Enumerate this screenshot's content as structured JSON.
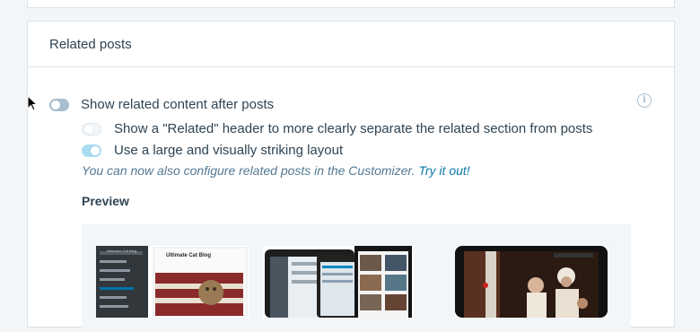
{
  "card": {
    "title": "Related posts"
  },
  "settings": {
    "show_related": {
      "label": "Show related content after posts",
      "enabled": false
    },
    "related_header": {
      "label": "Show a \"Related\" header to more clearly separate the related section from posts",
      "enabled": false
    },
    "large_layout": {
      "label": "Use a large and visually striking layout",
      "enabled": true
    }
  },
  "hint": {
    "text": "You can now also configure related posts in the Customizer.",
    "link": "Try it out!"
  },
  "preview": {
    "title": "Preview",
    "thumbnails": [
      {
        "heading": "Ultimate Cat Blog",
        "subheading": "Welcome Cat Blog"
      },
      {
        "heading": ""
      },
      {
        "heading": ""
      }
    ]
  },
  "icons": {
    "info": "info-icon",
    "cursor": "mouse-pointer-icon"
  },
  "colors": {
    "accent": "#00aadc",
    "toggle_off": "#a8bece",
    "toggle_on_disabled": "#a9dcf0"
  }
}
